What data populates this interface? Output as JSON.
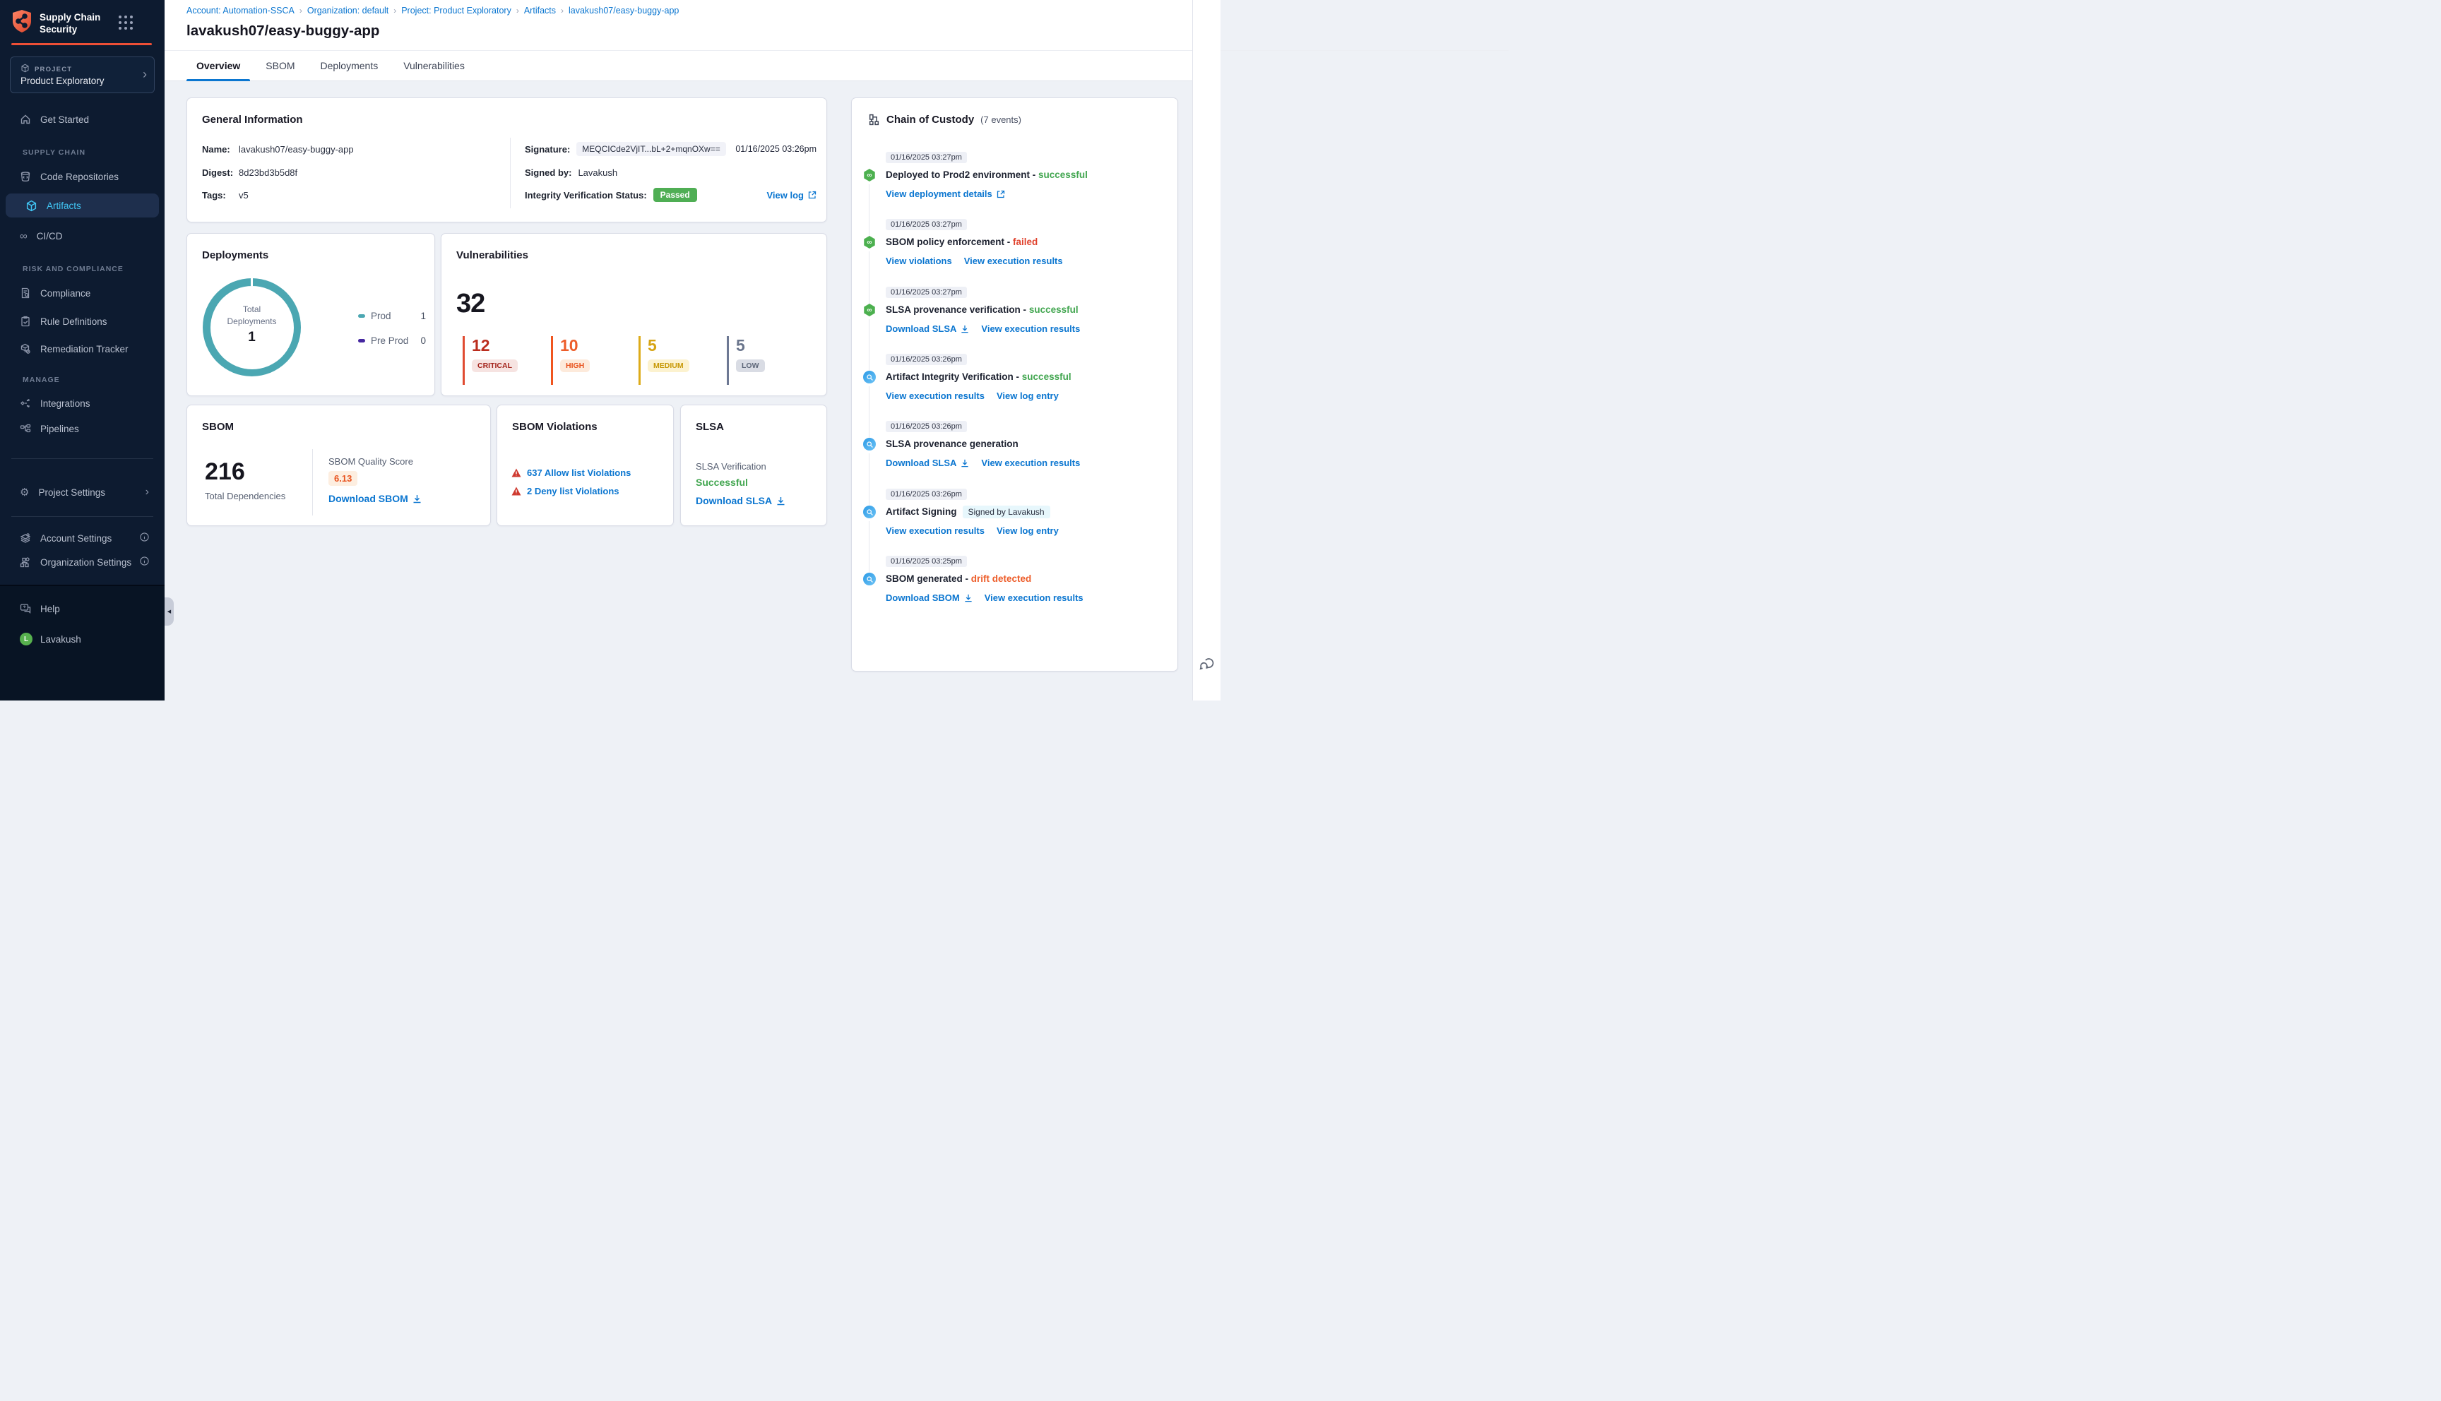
{
  "sidebar": {
    "title_line1": "Supply Chain",
    "title_line2": "Security",
    "project_label": "PROJECT",
    "project_name": "Product Exploratory",
    "sections": {
      "supply_chain": "SUPPLY CHAIN",
      "risk_and_compliance": "RISK AND COMPLIANCE",
      "manage": "MANAGE"
    },
    "items": {
      "get_started": "Get Started",
      "code_repositories": "Code Repositories",
      "artifacts": "Artifacts",
      "cicd": "CI/CD",
      "compliance": "Compliance",
      "rule_definitions": "Rule Definitions",
      "remediation_tracker": "Remediation Tracker",
      "integrations": "Integrations",
      "pipelines": "Pipelines",
      "project_settings": "Project Settings",
      "account_settings": "Account Settings",
      "organization_settings": "Organization Settings",
      "help": "Help"
    },
    "user": {
      "initial": "L",
      "name": "Lavakush"
    }
  },
  "header": {
    "breadcrumb": {
      "account": "Account: Automation-SSCA",
      "org": "Organization: default",
      "project": "Project: Product Exploratory",
      "section": "Artifacts",
      "artifact": "lavakush07/easy-buggy-app"
    },
    "title": "lavakush07/easy-buggy-app",
    "tabs": {
      "overview": "Overview",
      "sbom": "SBOM",
      "deployments": "Deployments",
      "vulnerabilities": "Vulnerabilities"
    }
  },
  "general_info": {
    "title": "General Information",
    "name_label": "Name:",
    "name": "lavakush07/easy-buggy-app",
    "digest_label": "Digest:",
    "digest": "8d23bd3b5d8f",
    "tags_label": "Tags:",
    "tags": "v5",
    "signature_label": "Signature:",
    "signature": "MEQCICde2VjIT...bL+2+mqnOXw==",
    "signature_time": "01/16/2025 03:26pm",
    "signed_by_label": "Signed by:",
    "signed_by": "Lavakush",
    "integrity_label": "Integrity Verification Status:",
    "integrity_status": "Passed",
    "view_log": "View log"
  },
  "deployments": {
    "title": "Deployments",
    "center_label_1": "Total",
    "center_label_2": "Deployments",
    "total": "1",
    "legend": [
      {
        "name": "Prod",
        "value": "1",
        "color": "#4BA7B2"
      },
      {
        "name": "Pre Prod",
        "value": "0",
        "color": "#4527A0"
      }
    ],
    "chart_data": {
      "type": "pie",
      "categories": [
        "Prod",
        "Pre Prod"
      ],
      "values": [
        1,
        0
      ],
      "title": "Total Deployments",
      "total": 1,
      "legend_position": "right"
    }
  },
  "vulnerabilities": {
    "title": "Vulnerabilities",
    "total": "32",
    "severities": [
      {
        "count": "12",
        "label": "CRITICAL",
        "color": "#bb2d1e"
      },
      {
        "count": "10",
        "label": "HIGH",
        "color": "#ed5d2a"
      },
      {
        "count": "5",
        "label": "MEDIUM",
        "color": "#d6a414"
      },
      {
        "count": "5",
        "label": "LOW",
        "color": "#6a758c"
      }
    ]
  },
  "sbom": {
    "title": "SBOM",
    "total": "216",
    "total_label": "Total Dependencies",
    "score_label": "SBOM Quality Score",
    "score": "6.13",
    "download": "Download SBOM"
  },
  "sbom_violations": {
    "title": "SBOM Violations",
    "allow": "637 Allow list Violations",
    "deny": "2 Deny list Violations"
  },
  "slsa": {
    "title": "SLSA",
    "verification_label": "SLSA Verification",
    "status": "Successful",
    "download": "Download SLSA"
  },
  "chain_of_custody": {
    "title": "Chain of Custody",
    "count": "(7 events)",
    "events": [
      {
        "time": "01/16/2025 03:27pm",
        "title": "Deployed to Prod2 environment - ",
        "status": "successful",
        "links": [
          {
            "label": "View deployment details"
          }
        ]
      },
      {
        "time": "01/16/2025 03:27pm",
        "title": "SBOM policy enforcement - ",
        "status": "failed",
        "links": [
          {
            "label": "View violations"
          },
          {
            "label": "View execution results"
          }
        ]
      },
      {
        "time": "01/16/2025 03:27pm",
        "title": "SLSA provenance verification - ",
        "status": "successful",
        "links": [
          {
            "label": "Download SLSA"
          },
          {
            "label": "View execution results"
          }
        ]
      },
      {
        "time": "01/16/2025 03:26pm",
        "title": "Artifact Integrity Verification - ",
        "status": "successful",
        "links": [
          {
            "label": "View execution results"
          },
          {
            "label": "View log entry"
          }
        ]
      },
      {
        "time": "01/16/2025 03:26pm",
        "title": "SLSA provenance generation",
        "status": "",
        "links": [
          {
            "label": "Download SLSA"
          },
          {
            "label": "View execution results"
          }
        ]
      },
      {
        "time": "01/16/2025 03:26pm",
        "title": "Artifact Signing",
        "status": "",
        "badge": "Signed by Lavakush",
        "links": [
          {
            "label": "View execution results"
          },
          {
            "label": "View log entry"
          }
        ]
      },
      {
        "time": "01/16/2025 03:25pm",
        "title": "SBOM generated - ",
        "status": "drift detected",
        "links": [
          {
            "label": "Download SBOM"
          },
          {
            "label": "View execution results"
          }
        ]
      }
    ]
  },
  "colors": {
    "accent_blue": "#0b76d0",
    "success_green": "#42a650",
    "error_red": "#e0432e",
    "warning_orange": "#ed5d2a",
    "passed_badge": "#4fae54",
    "donut_teal": "#4BA7B2",
    "preprod_purple": "#4527A0",
    "brand_red": "#ee4f36",
    "active_nav": "#41c6f5",
    "sidebar_bg": "#0d1b30"
  }
}
